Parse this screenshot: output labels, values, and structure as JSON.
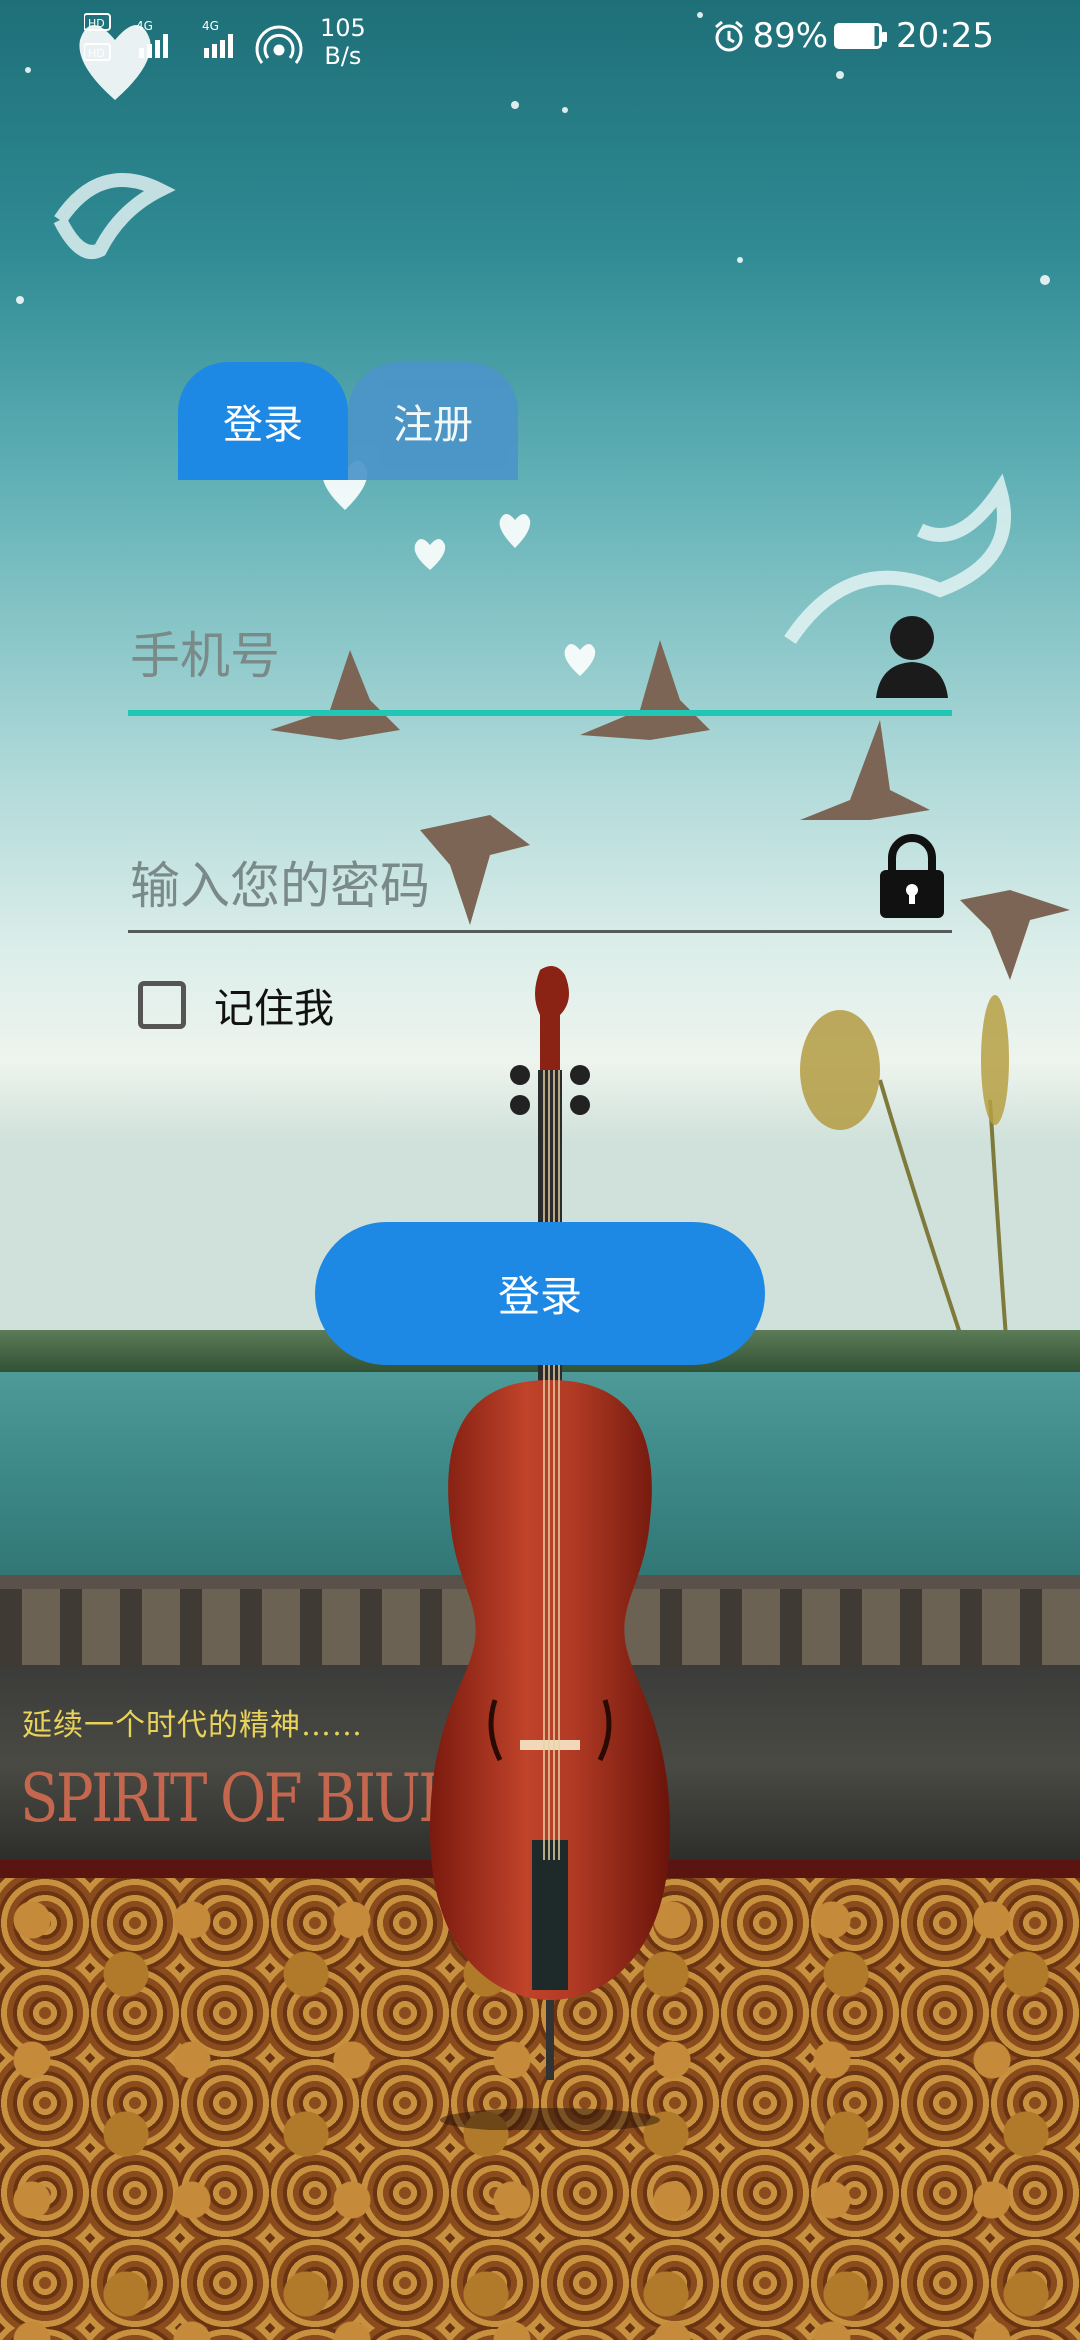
{
  "status_bar": {
    "left_badges": "HD 4G HD",
    "net_speed_value": "105",
    "net_speed_unit": "B/s",
    "battery_percent": "89%",
    "time": "20:25"
  },
  "background": {
    "wall_text_cn": "延续一个时代的精神……",
    "wall_text_en": "SPIRIT OF BIUDING..."
  },
  "tabs": [
    {
      "label": "登录",
      "selected": true
    },
    {
      "label": "注册",
      "selected": false
    }
  ],
  "form": {
    "phone_placeholder": "手机号",
    "password_placeholder": "输入您的密码",
    "remember_label": "记住我",
    "remember_checked": false,
    "submit_label": "登录"
  },
  "icons": {
    "user": "person-icon",
    "lock": "lock-icon",
    "alarm": "alarm-icon",
    "battery": "battery-icon",
    "hotspot": "hotspot-icon",
    "signal": "signal-icon"
  },
  "colors": {
    "primary": "#1e88e5",
    "accent_underline": "#21c6b4"
  }
}
